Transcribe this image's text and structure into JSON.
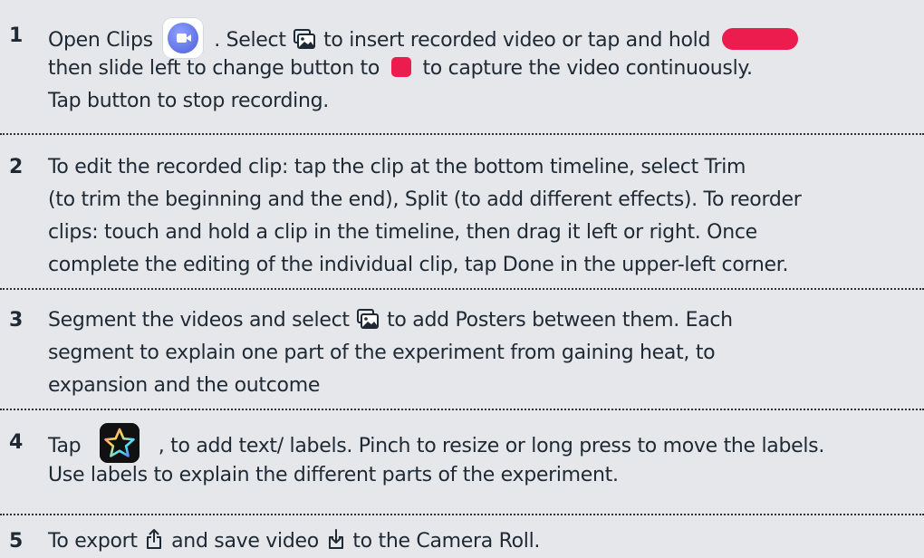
{
  "steps": [
    {
      "number": "1",
      "line1": {
        "a": "Open Clips",
        "b": ". Select",
        "c": "to insert recorded video or tap and hold"
      },
      "line2": {
        "a": "then slide left to change button to",
        "b": "to capture the video continuously."
      },
      "line3": "Tap button to stop recording."
    },
    {
      "number": "2",
      "lines": [
        "To edit the recorded clip:  tap the clip at the bottom timeline, select Trim",
        "(to trim the beginning and the end), Split (to add different effects). To reorder",
        "clips: touch and hold a clip in the timeline, then drag it left or right.  Once",
        "complete the editing of the individual clip, tap Done in the upper-left corner."
      ]
    },
    {
      "number": "3",
      "line1": {
        "a": "Segment the videos and select",
        "b": "to add Posters between them. Each"
      },
      "line2": "segment to explain one part of the experiment from gaining heat, to",
      "line3": "expansion and the outcome"
    },
    {
      "number": "4",
      "line1": {
        "a": "Tap",
        "b": ", to add text/ labels. Pinch to resize or long press to move the labels."
      },
      "line2": "Use labels to explain the different parts of the experiment."
    },
    {
      "number": "5",
      "line1": {
        "a": "To export",
        "b": "and save video",
        "c": "to the Camera Roll."
      }
    }
  ],
  "icons": {
    "clips_app": "clips-app-icon",
    "gallery": "photo-gallery-icon",
    "record_button": "record-button-icon",
    "record_locked": "record-stop-square-icon",
    "effects_app": "star-effects-icon",
    "export": "share-export-icon",
    "save": "save-download-icon"
  },
  "colors": {
    "background": "#e6e7eb",
    "record_red": "#ec1c4f",
    "text": "#1f2933"
  }
}
